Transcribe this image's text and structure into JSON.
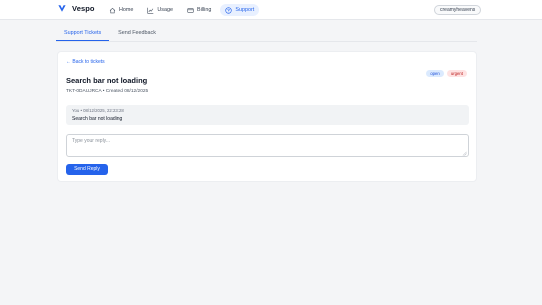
{
  "app": {
    "name": "Vespo"
  },
  "nav": {
    "items": [
      {
        "label": "Home",
        "icon": "home-icon",
        "active": false
      },
      {
        "label": "Usage",
        "icon": "chart-icon",
        "active": false
      },
      {
        "label": "Billing",
        "icon": "card-icon",
        "active": false
      },
      {
        "label": "Support",
        "icon": "help-icon",
        "active": true
      }
    ]
  },
  "user": {
    "name": "creamyheavens"
  },
  "tabs": [
    {
      "label": "Support Tickets",
      "active": true
    },
    {
      "label": "Send Feedback",
      "active": false
    }
  ],
  "ticket": {
    "back_label": "← Back to tickets",
    "title": "Search bar not loading",
    "meta": "TKT-0DAUJRCA • Created 08/12/2025",
    "status": "open",
    "priority": "urgent",
    "messages": [
      {
        "meta": "You • 08/12/2025, 22:23:28",
        "text": "Search bar not loading"
      }
    ]
  },
  "reply": {
    "placeholder": "Type your reply...",
    "value": "",
    "send_label": "Send Reply"
  },
  "colors": {
    "accent": "#2563eb",
    "status_open_bg": "#dbeafe",
    "status_urgent_bg": "#fee2e2"
  }
}
